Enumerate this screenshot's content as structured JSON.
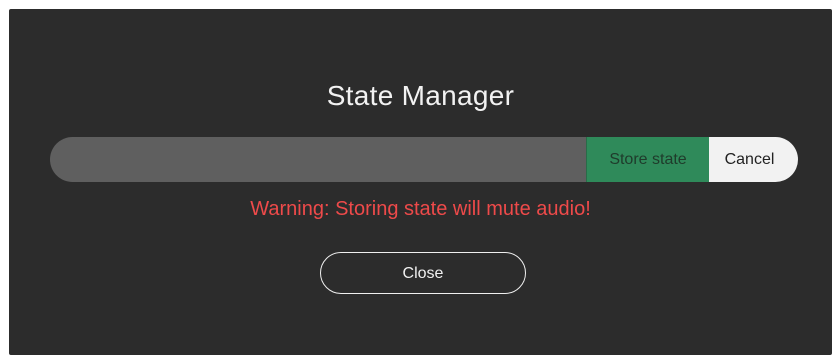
{
  "dialog": {
    "title": "State Manager",
    "state_input": {
      "value": "",
      "placeholder": ""
    },
    "store_button_label": "Store state",
    "cancel_button_label": "Cancel",
    "warning_text": "Warning: Storing state will mute audio!",
    "close_button_label": "Close"
  },
  "colors": {
    "dialog_background": "#2c2c2c",
    "input_background": "#5f5f5f",
    "store_button": "#2f8a5a",
    "cancel_button": "#f2f2f2",
    "warning": "#ee4a4a",
    "text": "#f2f2f2"
  }
}
